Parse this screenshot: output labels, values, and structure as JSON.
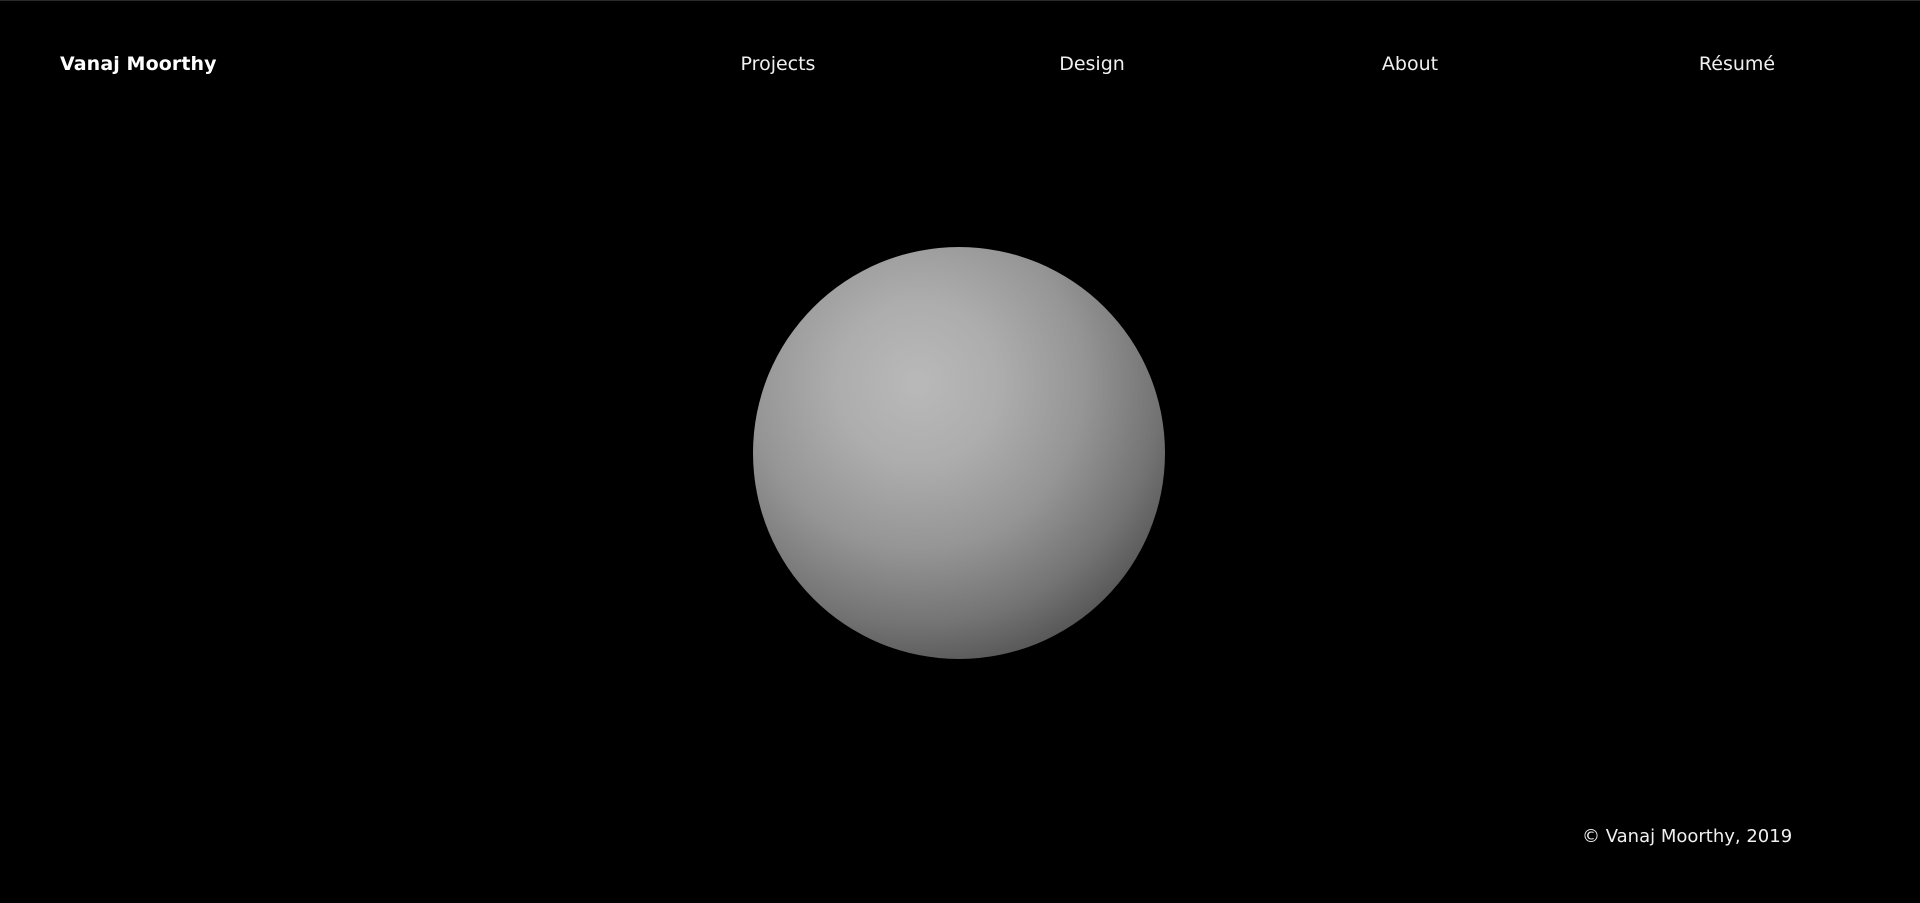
{
  "header": {
    "brand": "Vanaj Moorthy",
    "nav": [
      {
        "label": "Projects"
      },
      {
        "label": "Design"
      },
      {
        "label": "About"
      },
      {
        "label": "Résumé"
      }
    ]
  },
  "hero": {
    "visual": "sphere"
  },
  "footer": {
    "copyright": "© Vanaj Moorthy, 2019"
  },
  "colors": {
    "background": "#000000",
    "text": "#ffffff",
    "sphere_highlight": "#b9b9b9",
    "sphere_shadow": "#101010"
  }
}
